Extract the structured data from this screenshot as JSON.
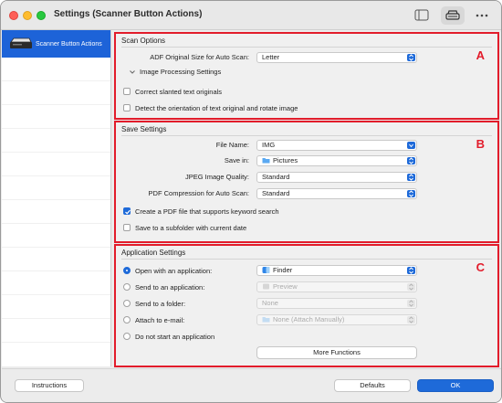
{
  "window": {
    "title": "Settings (Scanner Button Actions)"
  },
  "toolbar": {
    "sidebar_icon": "sidebar-icon",
    "scanner_icon": "scanner-icon",
    "more_icon": "ellipsis-icon"
  },
  "sidebar": {
    "items": [
      {
        "label": "Scanner Button Actions",
        "icon": "scanner-icon",
        "selected": true
      }
    ]
  },
  "scan_options": {
    "header": "Scan Options",
    "letter": "A",
    "adf_label": "ADF Original Size for Auto Scan:",
    "adf_value": "Letter",
    "image_processing": "Image Processing Settings",
    "correct_slanted": "Correct slanted text originals",
    "correct_slanted_checked": false,
    "detect_orientation": "Detect the orientation of text original and rotate image",
    "detect_orientation_checked": false
  },
  "save_settings": {
    "header": "Save Settings",
    "letter": "B",
    "file_name_label": "File Name:",
    "file_name_value": "IMG",
    "save_in_label": "Save in:",
    "save_in_value": "Pictures",
    "jpeg_label": "JPEG Image Quality:",
    "jpeg_value": "Standard",
    "pdf_label": "PDF Compression for Auto Scan:",
    "pdf_value": "Standard",
    "pdf_keyword": "Create a PDF file that supports keyword search",
    "pdf_keyword_checked": true,
    "subfolder": "Save to a subfolder with current date",
    "subfolder_checked": false
  },
  "application_settings": {
    "header": "Application Settings",
    "letter": "C",
    "open_with": "Open with an application:",
    "open_with_value": "Finder",
    "send_app": "Send to an application:",
    "send_app_value": "Preview",
    "send_folder": "Send to a folder:",
    "send_folder_value": "None",
    "attach_email": "Attach to e-mail:",
    "attach_email_value": "None (Attach Manually)",
    "no_app": "Do not start an application",
    "selected_option": "Open with an application:",
    "more_functions": "More Functions"
  },
  "footer": {
    "instructions": "Instructions",
    "defaults": "Defaults",
    "ok": "OK"
  },
  "colors": {
    "accent": "#1e6ad9",
    "highlight_border": "#e21c2b",
    "sidebar_selected": "#1d63d8"
  }
}
